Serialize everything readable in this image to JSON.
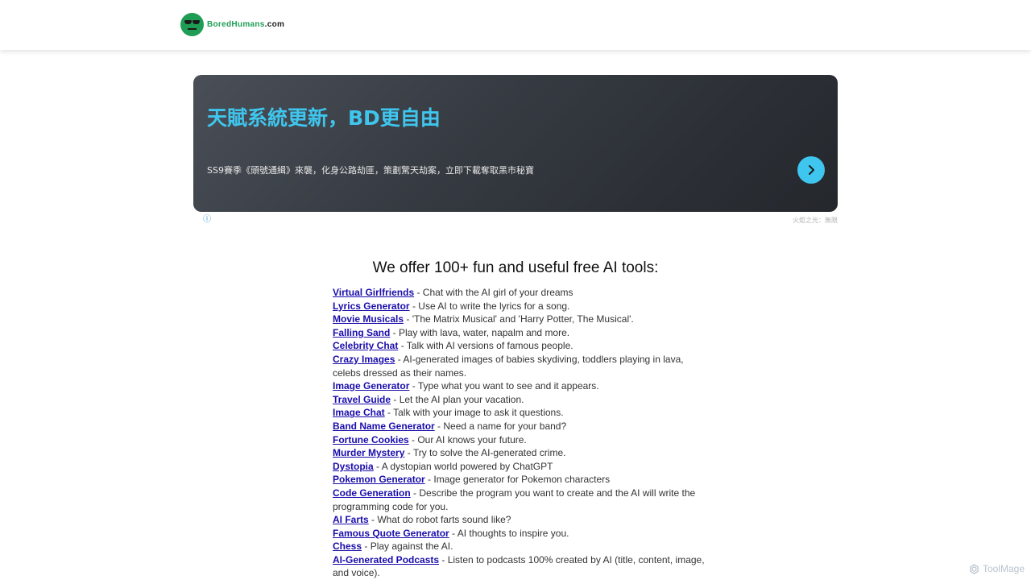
{
  "header": {
    "logo_name": "BoredHumans",
    "logo_tld": ".com"
  },
  "ad": {
    "title": "天賦系統更新，BD更自由",
    "description": "SS9賽季《頭號通緝》來襲，化身公路劫匪，策劃驚天劫案，立即下載奪取黑市秘寶",
    "info_icon": "ⓘ",
    "source": "火炬之光：無限"
  },
  "main": {
    "heading": "We offer 100+ fun and useful free AI tools:",
    "tools": [
      {
        "name": "Virtual Girlfriends",
        "desc": " - Chat with the AI girl of your dreams"
      },
      {
        "name": "Lyrics Generator",
        "desc": " - Use AI to write the lyrics for a song."
      },
      {
        "name": "Movie Musicals",
        "desc": " - 'The Matrix Musical' and 'Harry Potter, The Musical'."
      },
      {
        "name": "Falling Sand",
        "desc": " - Play with lava, water, napalm and more."
      },
      {
        "name": "Celebrity Chat",
        "desc": " - Talk with AI versions of famous people."
      },
      {
        "name": "Crazy Images",
        "desc": " - AI-generated images of babies skydiving, toddlers playing in lava, celebs dressed as their names."
      },
      {
        "name": "Image Generator",
        "desc": " - Type what you want to see and it appears."
      },
      {
        "name": "Travel Guide",
        "desc": " - Let the AI plan your vacation."
      },
      {
        "name": "Image Chat",
        "desc": " - Talk with your image to ask it questions."
      },
      {
        "name": "Band Name Generator",
        "desc": " - Need a name for your band?"
      },
      {
        "name": "Fortune Cookies",
        "desc": " - Our AI knows your future."
      },
      {
        "name": "Murder Mystery",
        "desc": " - Try to solve the AI-generated crime."
      },
      {
        "name": "Dystopia",
        "desc": " - A dystopian world powered by ChatGPT"
      },
      {
        "name": "Pokemon Generator",
        "desc": " - Image generator for Pokemon characters"
      },
      {
        "name": "Code Generation",
        "desc": " - Describe the program you want to create and the AI will write the programming code for you."
      },
      {
        "name": "AI Farts",
        "desc": " - What do robot farts sound like?"
      },
      {
        "name": "Famous Quote Generator",
        "desc": " - AI thoughts to inspire you."
      },
      {
        "name": "Chess",
        "desc": " - Play against the AI."
      },
      {
        "name": "AI-Generated Podcasts",
        "desc": " - Listen to podcasts 100% created by AI (title, content, image, and voice)."
      }
    ]
  },
  "watermark": {
    "text": "ToolMage"
  },
  "colors": {
    "brand_green": "#1f9d55",
    "link_blue": "#1a0dab",
    "ad_accent": "#3fc6ee"
  },
  "icons": {
    "logo": "bored-face-logo-icon",
    "ad_button": "chevron-right-icon",
    "ad_info": "info-icon",
    "watermark": "toolmage-logo-icon"
  }
}
